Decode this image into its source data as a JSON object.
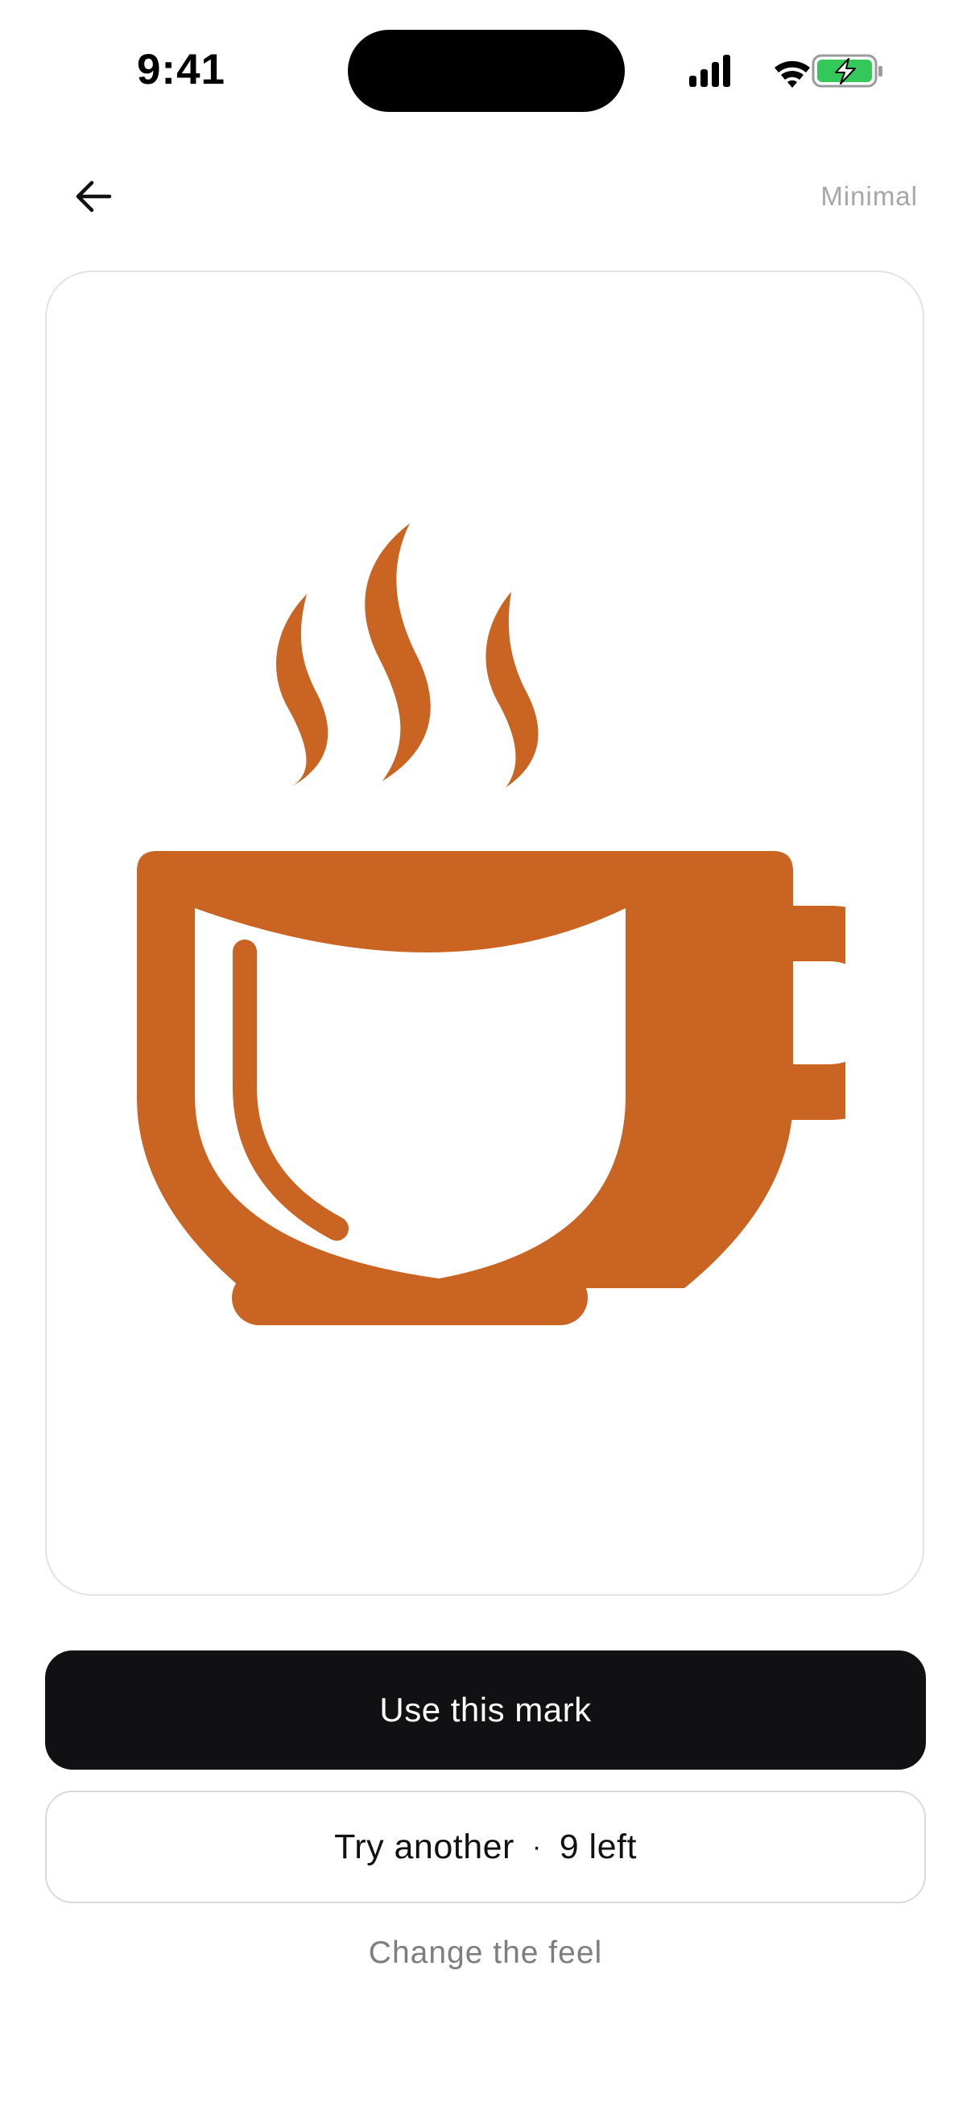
{
  "status_bar": {
    "time": "9:41",
    "icons": [
      "cellular-signal-icon",
      "wifi-icon",
      "battery-charging-icon"
    ]
  },
  "header": {
    "back_icon": "arrow-left-icon",
    "style_label": "Minimal"
  },
  "preview": {
    "mark_icon": "coffee-cup-steam-icon",
    "mark_color": "#C96423"
  },
  "actions": {
    "primary_label": "Use this mark",
    "secondary_label": "Try another",
    "secondary_separator": "·",
    "remaining_label": "9 left",
    "link_label": "Change the feel"
  },
  "colors": {
    "primary_button": "#111114",
    "battery_fill": "#34C759",
    "muted_text": "#A6A6AB"
  }
}
